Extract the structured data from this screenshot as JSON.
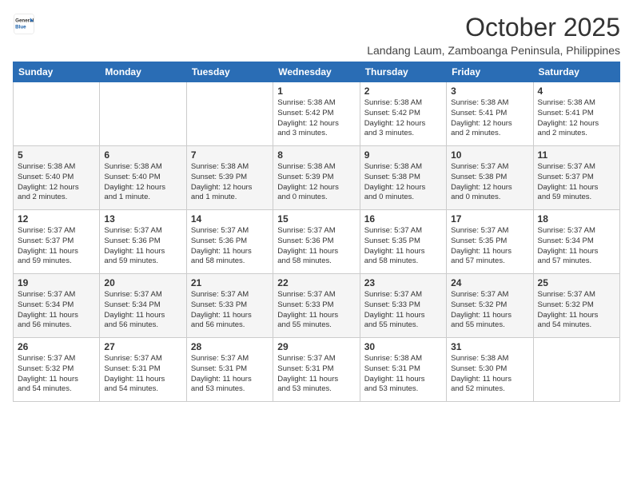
{
  "logo": {
    "general": "General",
    "blue": "Blue"
  },
  "title": "October 2025",
  "location": "Landang Laum, Zamboanga Peninsula, Philippines",
  "weekdays": [
    "Sunday",
    "Monday",
    "Tuesday",
    "Wednesday",
    "Thursday",
    "Friday",
    "Saturday"
  ],
  "weeks": [
    [
      {
        "day": "",
        "info": ""
      },
      {
        "day": "",
        "info": ""
      },
      {
        "day": "",
        "info": ""
      },
      {
        "day": "1",
        "info": "Sunrise: 5:38 AM\nSunset: 5:42 PM\nDaylight: 12 hours\nand 3 minutes."
      },
      {
        "day": "2",
        "info": "Sunrise: 5:38 AM\nSunset: 5:42 PM\nDaylight: 12 hours\nand 3 minutes."
      },
      {
        "day": "3",
        "info": "Sunrise: 5:38 AM\nSunset: 5:41 PM\nDaylight: 12 hours\nand 2 minutes."
      },
      {
        "day": "4",
        "info": "Sunrise: 5:38 AM\nSunset: 5:41 PM\nDaylight: 12 hours\nand 2 minutes."
      }
    ],
    [
      {
        "day": "5",
        "info": "Sunrise: 5:38 AM\nSunset: 5:40 PM\nDaylight: 12 hours\nand 2 minutes."
      },
      {
        "day": "6",
        "info": "Sunrise: 5:38 AM\nSunset: 5:40 PM\nDaylight: 12 hours\nand 1 minute."
      },
      {
        "day": "7",
        "info": "Sunrise: 5:38 AM\nSunset: 5:39 PM\nDaylight: 12 hours\nand 1 minute."
      },
      {
        "day": "8",
        "info": "Sunrise: 5:38 AM\nSunset: 5:39 PM\nDaylight: 12 hours\nand 0 minutes."
      },
      {
        "day": "9",
        "info": "Sunrise: 5:38 AM\nSunset: 5:38 PM\nDaylight: 12 hours\nand 0 minutes."
      },
      {
        "day": "10",
        "info": "Sunrise: 5:37 AM\nSunset: 5:38 PM\nDaylight: 12 hours\nand 0 minutes."
      },
      {
        "day": "11",
        "info": "Sunrise: 5:37 AM\nSunset: 5:37 PM\nDaylight: 11 hours\nand 59 minutes."
      }
    ],
    [
      {
        "day": "12",
        "info": "Sunrise: 5:37 AM\nSunset: 5:37 PM\nDaylight: 11 hours\nand 59 minutes."
      },
      {
        "day": "13",
        "info": "Sunrise: 5:37 AM\nSunset: 5:36 PM\nDaylight: 11 hours\nand 59 minutes."
      },
      {
        "day": "14",
        "info": "Sunrise: 5:37 AM\nSunset: 5:36 PM\nDaylight: 11 hours\nand 58 minutes."
      },
      {
        "day": "15",
        "info": "Sunrise: 5:37 AM\nSunset: 5:36 PM\nDaylight: 11 hours\nand 58 minutes."
      },
      {
        "day": "16",
        "info": "Sunrise: 5:37 AM\nSunset: 5:35 PM\nDaylight: 11 hours\nand 58 minutes."
      },
      {
        "day": "17",
        "info": "Sunrise: 5:37 AM\nSunset: 5:35 PM\nDaylight: 11 hours\nand 57 minutes."
      },
      {
        "day": "18",
        "info": "Sunrise: 5:37 AM\nSunset: 5:34 PM\nDaylight: 11 hours\nand 57 minutes."
      }
    ],
    [
      {
        "day": "19",
        "info": "Sunrise: 5:37 AM\nSunset: 5:34 PM\nDaylight: 11 hours\nand 56 minutes."
      },
      {
        "day": "20",
        "info": "Sunrise: 5:37 AM\nSunset: 5:34 PM\nDaylight: 11 hours\nand 56 minutes."
      },
      {
        "day": "21",
        "info": "Sunrise: 5:37 AM\nSunset: 5:33 PM\nDaylight: 11 hours\nand 56 minutes."
      },
      {
        "day": "22",
        "info": "Sunrise: 5:37 AM\nSunset: 5:33 PM\nDaylight: 11 hours\nand 55 minutes."
      },
      {
        "day": "23",
        "info": "Sunrise: 5:37 AM\nSunset: 5:33 PM\nDaylight: 11 hours\nand 55 minutes."
      },
      {
        "day": "24",
        "info": "Sunrise: 5:37 AM\nSunset: 5:32 PM\nDaylight: 11 hours\nand 55 minutes."
      },
      {
        "day": "25",
        "info": "Sunrise: 5:37 AM\nSunset: 5:32 PM\nDaylight: 11 hours\nand 54 minutes."
      }
    ],
    [
      {
        "day": "26",
        "info": "Sunrise: 5:37 AM\nSunset: 5:32 PM\nDaylight: 11 hours\nand 54 minutes."
      },
      {
        "day": "27",
        "info": "Sunrise: 5:37 AM\nSunset: 5:31 PM\nDaylight: 11 hours\nand 54 minutes."
      },
      {
        "day": "28",
        "info": "Sunrise: 5:37 AM\nSunset: 5:31 PM\nDaylight: 11 hours\nand 53 minutes."
      },
      {
        "day": "29",
        "info": "Sunrise: 5:37 AM\nSunset: 5:31 PM\nDaylight: 11 hours\nand 53 minutes."
      },
      {
        "day": "30",
        "info": "Sunrise: 5:38 AM\nSunset: 5:31 PM\nDaylight: 11 hours\nand 53 minutes."
      },
      {
        "day": "31",
        "info": "Sunrise: 5:38 AM\nSunset: 5:30 PM\nDaylight: 11 hours\nand 52 minutes."
      },
      {
        "day": "",
        "info": ""
      }
    ]
  ]
}
